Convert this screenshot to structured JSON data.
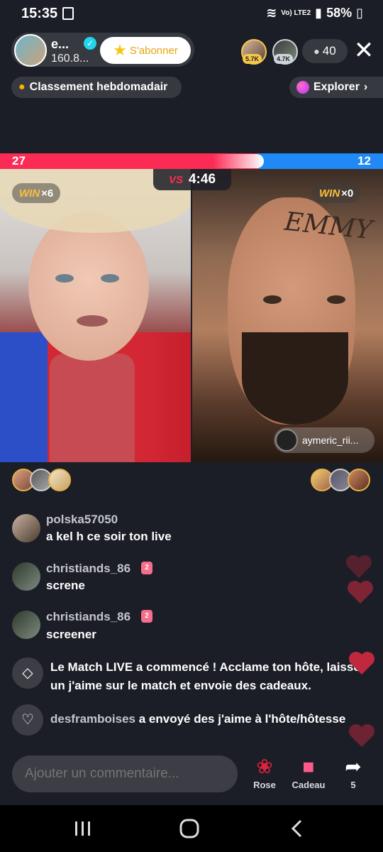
{
  "status_bar": {
    "time": "15:35",
    "network": "Vo) LTE2",
    "battery": "58%"
  },
  "host": {
    "name": "e...",
    "followers": "160.8...",
    "subscribe_label": "S'abonner",
    "verified": true
  },
  "top_viewers": [
    {
      "badge": "5.7K",
      "badge_color": "#f7c84a"
    },
    {
      "badge": "4.7K",
      "badge_color": "#cfd5dc"
    }
  ],
  "viewer_count": "40",
  "ranking_label": "Classement hebdomadair",
  "explore_label": "Explorer",
  "battle": {
    "score_left": "27",
    "score_right": "12",
    "timer": "4:46",
    "vs_label": "VS",
    "left_wins": "×6",
    "right_wins": "×0",
    "win_label": "WIN",
    "forehead_text": "EMMY",
    "opponent_name": "aymeric_rii..."
  },
  "chat": [
    {
      "user": "polska57050",
      "text": "a kel h ce soir ton live",
      "badge": ""
    },
    {
      "user": "christiands_86",
      "text": "screne",
      "badge": "2"
    },
    {
      "user": "christiands_86",
      "text": "screener",
      "badge": "2"
    }
  ],
  "system_messages": [
    {
      "icon": "match-icon",
      "text": "Le Match LIVE a commencé ! Acclame ton hôte, laisse un j'aime sur le match et envoie des cadeaux."
    },
    {
      "icon": "heart-outline-icon",
      "user": "desframboises",
      "text": "a envoyé des j'aime à l'hôte/hôtesse"
    }
  ],
  "bottom": {
    "comment_placeholder": "Ajouter un commentaire...",
    "rose_label": "Rose",
    "gift_label": "Cadeau",
    "share_count": "5"
  },
  "colors": {
    "team_red": "#fc2b55",
    "team_blue": "#2189f5",
    "background": "#1c1e27"
  }
}
